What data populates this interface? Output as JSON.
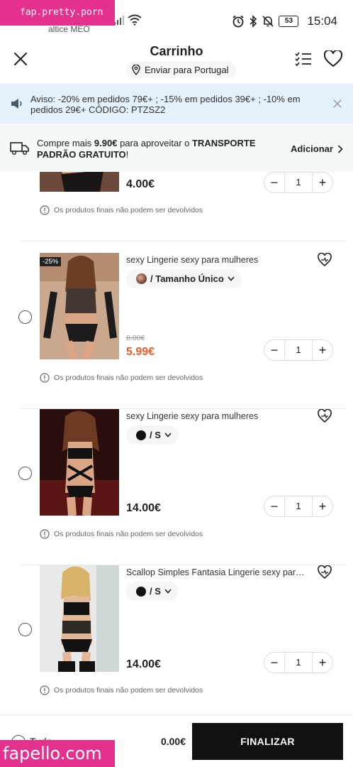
{
  "watermark": {
    "top": "fap.pretty.porn",
    "bottom": "fapello.com"
  },
  "status": {
    "carrier": "altice MEO",
    "battery": "53",
    "time": "15:04"
  },
  "header": {
    "title": "Carrinho",
    "ship_to": "Enviar para Portugal"
  },
  "notice": {
    "text": "Aviso: -20% em pedidos 79€+ ; -15% em pedidos 39€+ ; -10% em pedidos 29€+ CÓDIGO: PTZSZ2"
  },
  "shipping": {
    "prefix": "Compre mais ",
    "amount": "9.90€",
    "middle": " para aproveitar o ",
    "highlight": "TRANSPORTE PADRÃO GRATUITO",
    "suffix": "!",
    "action": "Adicionar"
  },
  "items": [
    {
      "title": "",
      "variant": "",
      "old_price": "",
      "price": "4.00€",
      "qty": "1",
      "notice": "Os produtos finais não podem ser devolvidos",
      "discount": ""
    },
    {
      "title": "sexy Lingerie sexy para mulheres",
      "variant": "/ Tamanho Único",
      "old_price": "8.00€",
      "price": "5.99€",
      "qty": "1",
      "notice": "Os produtos finais não podem ser devolvidos",
      "discount": "-25%"
    },
    {
      "title": "sexy Lingerie sexy para mulheres",
      "variant": "/ S",
      "old_price": "",
      "price": "14.00€",
      "qty": "1",
      "notice": "Os produtos finais não podem ser devolvidos",
      "discount": ""
    },
    {
      "title": "Scallop Simples Fantasia Lingerie sexy para mulheres",
      "variant": "/ S",
      "old_price": "",
      "price": "14.00€",
      "qty": "1",
      "notice": "Os produtos finais não podem ser devolvidos",
      "discount": ""
    }
  ],
  "footer": {
    "all_label": "Tudo",
    "total": "0.00€",
    "checkout": "FINALIZAR"
  },
  "colors": {
    "sale": "#f05a24",
    "notice_bg": "#e4f1fb",
    "shipping_bg": "#f3faf9",
    "watermark": "#e5318e"
  }
}
